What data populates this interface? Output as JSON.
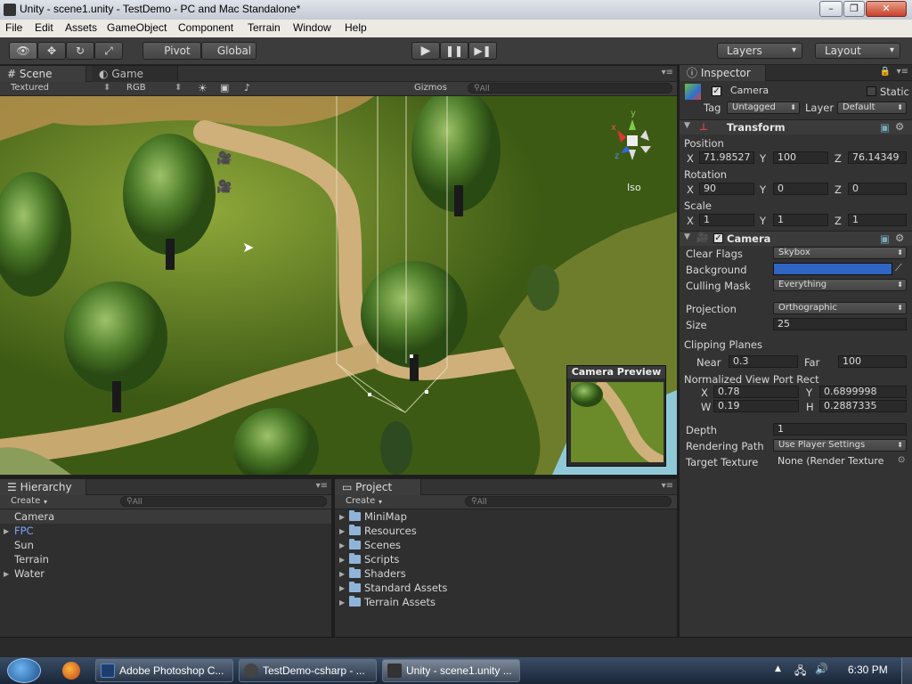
{
  "window": {
    "title": "Unity - scene1.unity - TestDemo - PC and Mac Standalone*",
    "minimize": "–",
    "maximize": "❐",
    "close": "✕"
  },
  "menu": [
    "File",
    "Edit",
    "Assets",
    "GameObject",
    "Component",
    "Terrain",
    "Window",
    "Help"
  ],
  "toolbar": {
    "pivot": "Pivot",
    "global": "Global",
    "layers": "Layers",
    "layout": "Layout"
  },
  "scene": {
    "tab_scene": "Scene",
    "tab_game": "Game",
    "render_mode": "Textured",
    "color_mode": "RGB",
    "gizmos": "Gizmos",
    "search_placeholder": "All",
    "gizmo_label": "Iso",
    "axis_y": "y",
    "axis_x": "x",
    "axis_z": "z",
    "camera_preview_title": "Camera Preview"
  },
  "inspector": {
    "tab": "Inspector",
    "object_name": "Camera",
    "static_label": "Static",
    "tag_label": "Tag",
    "tag_value": "Untagged",
    "layer_label": "Layer",
    "layer_value": "Default",
    "transform": {
      "title": "Transform",
      "position_label": "Position",
      "pos_x": "71.98527",
      "pos_y": "100",
      "pos_z": "76.14349",
      "rotation_label": "Rotation",
      "rot_x": "90",
      "rot_y": "0",
      "rot_z": "0",
      "scale_label": "Scale",
      "scale_x": "1",
      "scale_y": "1",
      "scale_z": "1",
      "x": "X",
      "y": "Y",
      "z": "Z"
    },
    "camera": {
      "title": "Camera",
      "clear_flags_label": "Clear Flags",
      "clear_flags": "Skybox",
      "background_label": "Background",
      "background_color": "#2f66c4",
      "culling_mask_label": "Culling Mask",
      "culling_mask": "Everything",
      "projection_label": "Projection",
      "projection": "Orthographic",
      "size_label": "Size",
      "size": "25",
      "clipping_label": "Clipping Planes",
      "near_label": "Near",
      "near": "0.3",
      "far_label": "Far",
      "far": "100",
      "viewport_label": "Normalized View Port Rect",
      "vx_label": "X",
      "vx": "0.78",
      "vy_label": "Y",
      "vy": "0.6899998",
      "vw_label": "W",
      "vw": "0.19",
      "vh_label": "H",
      "vh": "0.2887335",
      "depth_label": "Depth",
      "depth": "1",
      "render_path_label": "Rendering Path",
      "render_path": "Use Player Settings",
      "target_texture_label": "Target Texture",
      "target_texture": "None (Render Texture"
    }
  },
  "hierarchy": {
    "tab": "Hierarchy",
    "create": "Create",
    "search_placeholder": "All",
    "items": [
      "Camera",
      "FPC",
      "Sun",
      "Terrain",
      "Water"
    ]
  },
  "project": {
    "tab": "Project",
    "create": "Create",
    "search_placeholder": "All",
    "items": [
      "MiniMap",
      "Resources",
      "Scenes",
      "Scripts",
      "Shaders",
      "Standard Assets",
      "Terrain Assets"
    ]
  },
  "taskbar": {
    "items": [
      "Adobe Photoshop C...",
      "TestDemo-csharp - ...",
      "Unity - scene1.unity ..."
    ],
    "clock": "6:30 PM"
  }
}
